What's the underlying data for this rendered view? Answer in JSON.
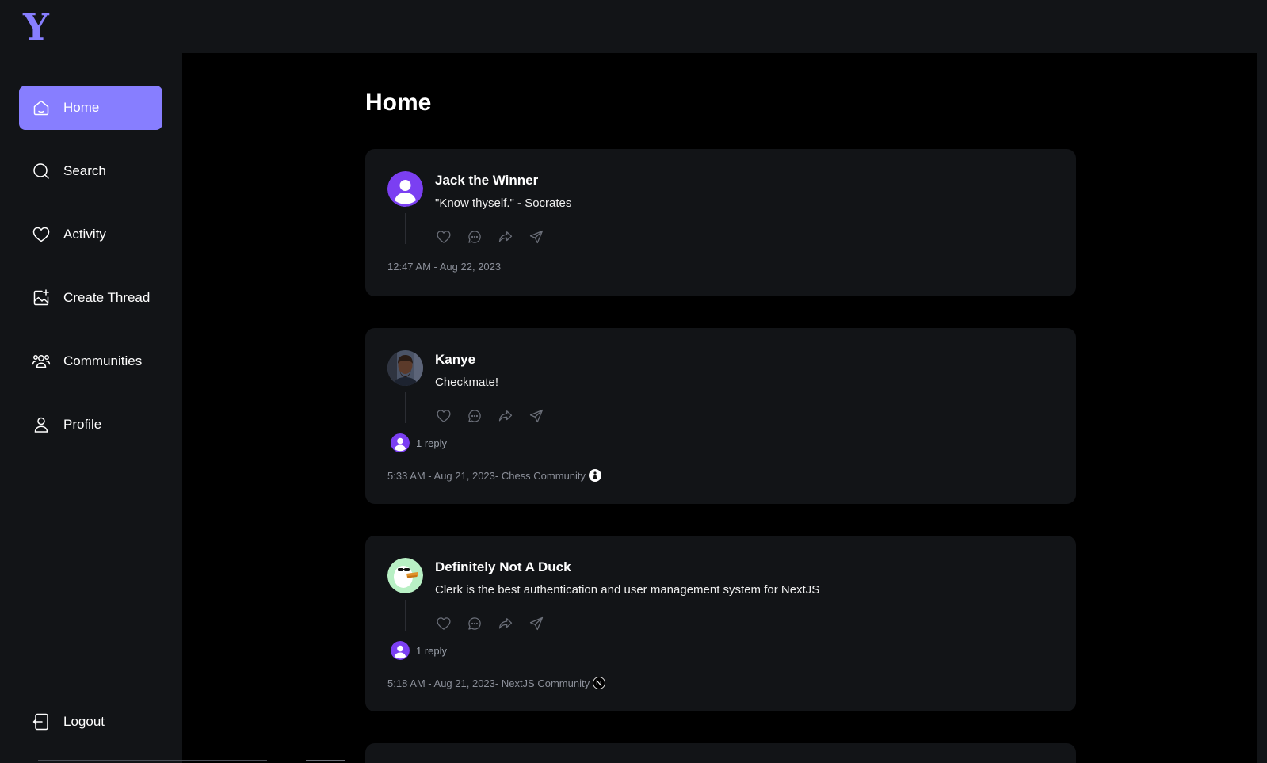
{
  "app": {
    "logo": "Y"
  },
  "sidebar": {
    "items": [
      {
        "label": "Home",
        "icon": "home-icon",
        "active": true
      },
      {
        "label": "Search",
        "icon": "search-icon"
      },
      {
        "label": "Activity",
        "icon": "heart-icon"
      },
      {
        "label": "Create Thread",
        "icon": "image-plus-icon"
      },
      {
        "label": "Communities",
        "icon": "users-icon"
      },
      {
        "label": "Profile",
        "icon": "user-icon"
      }
    ],
    "logout": {
      "label": "Logout",
      "icon": "logout-icon"
    }
  },
  "main": {
    "title": "Home",
    "threads": [
      {
        "author": "Jack the Winner",
        "content": "\"Know thyself.\" - Socrates",
        "timestamp": "12:47 AM - Aug 22, 2023",
        "avatar": "default-user-avatar"
      },
      {
        "author": "Kanye",
        "content": "Checkmate!",
        "replies": "1 reply",
        "timestamp": "5:33 AM - Aug 21, 2023",
        "community": "- Chess Community",
        "avatar": "photo-avatar",
        "community_icon": "chess-pawn-icon"
      },
      {
        "author": "Definitely Not A Duck",
        "content": "Clerk is the best authentication and user management system for NextJS",
        "replies": "1 reply",
        "timestamp": "5:18 AM - Aug 21, 2023",
        "community": "- NextJS Community",
        "avatar": "duck-avatar",
        "community_icon": "nextjs-logo-icon"
      }
    ]
  },
  "colors": {
    "accent": "#877eff",
    "sidebar_bg": "#121417",
    "card_bg": "#121417",
    "main_bg": "#000000"
  }
}
